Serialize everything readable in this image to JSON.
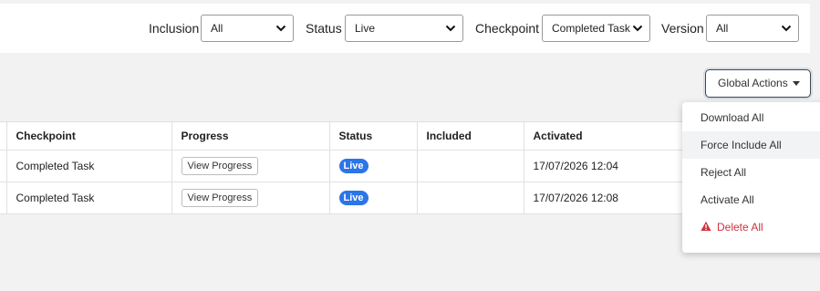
{
  "filters": {
    "inclusion": {
      "label": "Inclusion",
      "value": "All"
    },
    "status": {
      "label": "Status",
      "value": "Live"
    },
    "checkpoint": {
      "label": "Checkpoint",
      "value": "Completed Task"
    },
    "version": {
      "label": "Version",
      "value": "All"
    }
  },
  "global_actions": {
    "label": "Global Actions",
    "menu": [
      "Download All",
      "Force Include All",
      "Reject All",
      "Activate All",
      "Delete All"
    ],
    "hovered_item": "Force Include All",
    "danger_item": "Delete All"
  },
  "table": {
    "columns": [
      "Checkpoint",
      "Progress",
      "Status",
      "Included",
      "Activated"
    ],
    "rows": [
      {
        "checkpoint": "Completed Task",
        "progress": "View Progress",
        "status": "Live",
        "included": "",
        "activated": "17/07/2026 12:04"
      },
      {
        "checkpoint": "Completed Task",
        "progress": "View Progress",
        "status": "Live",
        "included": "",
        "activated": "17/07/2026 12:08"
      }
    ]
  },
  "colors": {
    "live_badge": "#2b75e8",
    "danger": "#d0313e",
    "page_bg": "#f2f2f2"
  }
}
